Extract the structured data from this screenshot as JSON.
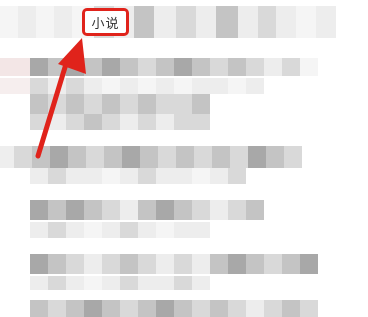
{
  "nav": {
    "highlighted_tab_label": "小说"
  },
  "annotation": {
    "highlight_color": "#e0231b",
    "arrow_color": "#e0231b"
  },
  "pixelation": {
    "palette": [
      "#ededed",
      "#d9d9d9",
      "#c4c4c4",
      "#a8a8a8",
      "#8f8f8f",
      "#f5f5f5"
    ]
  }
}
